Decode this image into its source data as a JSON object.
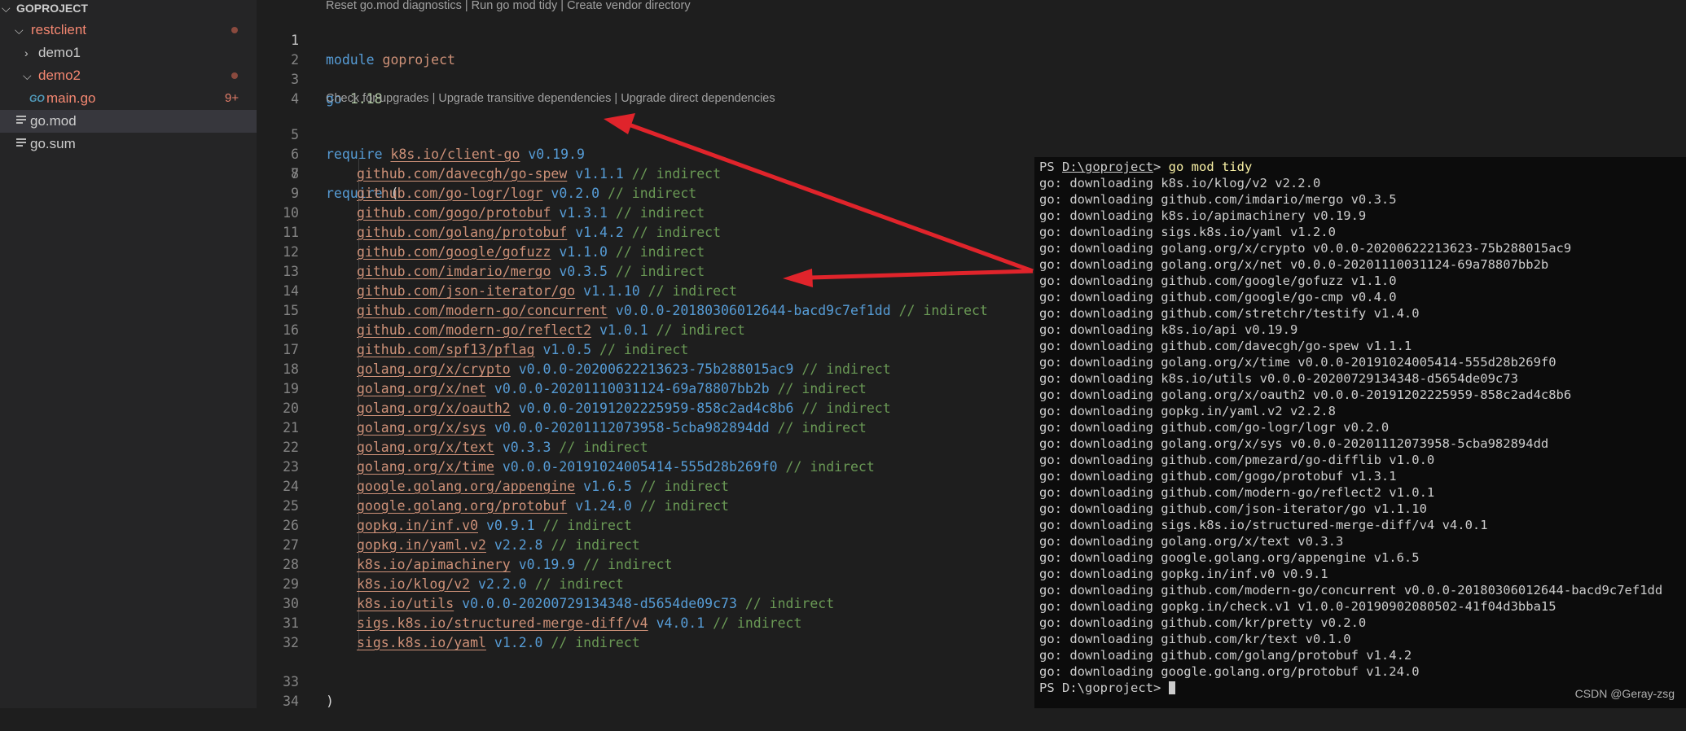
{
  "explorer": {
    "root": "GOPROJECT",
    "items": [
      {
        "label": "restclient",
        "kind": "folder-open",
        "modified": true
      },
      {
        "label": "demo1",
        "kind": "folder-closed"
      },
      {
        "label": "demo2",
        "kind": "folder-open",
        "modified": true
      },
      {
        "label": "main.go",
        "kind": "go-file",
        "problems": "9+",
        "icon_text": "GO"
      },
      {
        "label": "go.mod",
        "kind": "file",
        "selected": true
      },
      {
        "label": "go.sum",
        "kind": "file"
      }
    ]
  },
  "editor": {
    "codelens_top": "Reset go.mod diagnostics | Run go mod tidy | Create vendor directory",
    "codelens_require": "Check for upgrades | Upgrade transitive dependencies | Upgrade direct dependencies",
    "module_kw": "module",
    "module_name": "goproject",
    "go_kw": "go",
    "go_version": "1.18",
    "require_kw": "require",
    "direct_require": {
      "module": "k8s.io/client-go",
      "version": "v0.19.9"
    },
    "open_paren": "(",
    "close_paren": ")",
    "indirect_comment": "// indirect",
    "requires": [
      {
        "module": "github.com/davecgh/go-spew",
        "version": "v1.1.1"
      },
      {
        "module": "github.com/go-logr/logr",
        "version": "v0.2.0"
      },
      {
        "module": "github.com/gogo/protobuf",
        "version": "v1.3.1"
      },
      {
        "module": "github.com/golang/protobuf",
        "version": "v1.4.2"
      },
      {
        "module": "github.com/google/gofuzz",
        "version": "v1.1.0"
      },
      {
        "module": "github.com/imdario/mergo",
        "version": "v0.3.5"
      },
      {
        "module": "github.com/json-iterator/go",
        "version": "v1.1.10"
      },
      {
        "module": "github.com/modern-go/concurrent",
        "version": "v0.0.0-20180306012644-bacd9c7ef1dd"
      },
      {
        "module": "github.com/modern-go/reflect2",
        "version": "v1.0.1"
      },
      {
        "module": "github.com/spf13/pflag",
        "version": "v1.0.5"
      },
      {
        "module": "golang.org/x/crypto",
        "version": "v0.0.0-20200622213623-75b288015ac9"
      },
      {
        "module": "golang.org/x/net",
        "version": "v0.0.0-20201110031124-69a78807bb2b"
      },
      {
        "module": "golang.org/x/oauth2",
        "version": "v0.0.0-20191202225959-858c2ad4c8b6"
      },
      {
        "module": "golang.org/x/sys",
        "version": "v0.0.0-20201112073958-5cba982894dd"
      },
      {
        "module": "golang.org/x/text",
        "version": "v0.3.3"
      },
      {
        "module": "golang.org/x/time",
        "version": "v0.0.0-20191024005414-555d28b269f0"
      },
      {
        "module": "google.golang.org/appengine",
        "version": "v1.6.5"
      },
      {
        "module": "google.golang.org/protobuf",
        "version": "v1.24.0"
      },
      {
        "module": "gopkg.in/inf.v0",
        "version": "v0.9.1"
      },
      {
        "module": "gopkg.in/yaml.v2",
        "version": "v2.2.8"
      },
      {
        "module": "k8s.io/apimachinery",
        "version": "v0.19.9"
      },
      {
        "module": "k8s.io/klog/v2",
        "version": "v2.2.0"
      },
      {
        "module": "k8s.io/utils",
        "version": "v0.0.0-20200729134348-d5654de09c73"
      },
      {
        "module": "sigs.k8s.io/structured-merge-diff/v4",
        "version": "v4.0.1"
      },
      {
        "module": "sigs.k8s.io/yaml",
        "version": "v1.2.0"
      }
    ],
    "line_numbers": [
      "1",
      "2",
      "3",
      "4",
      "5",
      "6",
      "7",
      "8",
      "9",
      "10",
      "11",
      "12",
      "13",
      "14",
      "15",
      "16",
      "17",
      "18",
      "19",
      "20",
      "21",
      "22",
      "23",
      "24",
      "25",
      "26",
      "27",
      "28",
      "29",
      "30",
      "31",
      "32",
      "33",
      "34"
    ]
  },
  "terminal": {
    "prompt_prefix": "PS ",
    "prompt_path": "D:\\goproject",
    "prompt_suffix": "> ",
    "command": "go mod tidy",
    "output": [
      "go: downloading k8s.io/klog/v2 v2.2.0",
      "go: downloading github.com/imdario/mergo v0.3.5",
      "go: downloading k8s.io/apimachinery v0.19.9",
      "go: downloading sigs.k8s.io/yaml v1.2.0",
      "go: downloading golang.org/x/crypto v0.0.0-20200622213623-75b288015ac9",
      "go: downloading golang.org/x/net v0.0.0-20201110031124-69a78807bb2b",
      "go: downloading github.com/google/gofuzz v1.1.0",
      "go: downloading github.com/google/go-cmp v0.4.0",
      "go: downloading github.com/stretchr/testify v1.4.0",
      "go: downloading k8s.io/api v0.19.9",
      "go: downloading github.com/davecgh/go-spew v1.1.1",
      "go: downloading golang.org/x/time v0.0.0-20191024005414-555d28b269f0",
      "go: downloading k8s.io/utils v0.0.0-20200729134348-d5654de09c73",
      "go: downloading golang.org/x/oauth2 v0.0.0-20191202225959-858c2ad4c8b6",
      "go: downloading gopkg.in/yaml.v2 v2.2.8",
      "go: downloading github.com/go-logr/logr v0.2.0",
      "go: downloading golang.org/x/sys v0.0.0-20201112073958-5cba982894dd",
      "go: downloading github.com/pmezard/go-difflib v1.0.0",
      "go: downloading github.com/gogo/protobuf v1.3.1",
      "go: downloading github.com/modern-go/reflect2 v1.0.1",
      "go: downloading github.com/json-iterator/go v1.1.10",
      "go: downloading sigs.k8s.io/structured-merge-diff/v4 v4.0.1",
      "go: downloading golang.org/x/text v0.3.3",
      "go: downloading google.golang.org/appengine v1.6.5",
      "go: downloading gopkg.in/inf.v0 v0.9.1",
      "go: downloading github.com/modern-go/concurrent v0.0.0-20180306012644-bacd9c7ef1dd",
      "go: downloading gopkg.in/check.v1 v1.0.0-20190902080502-41f04d3bba15",
      "go: downloading github.com/kr/pretty v0.2.0",
      "go: downloading github.com/kr/text v0.1.0",
      "go: downloading github.com/golang/protobuf v1.4.2",
      "go: downloading google.golang.org/protobuf v1.24.0"
    ],
    "final_prompt": "PS D:\\goproject> "
  },
  "watermark": "CSDN @Geray-zsg",
  "colors": {
    "annotation_arrow": "#e0242b",
    "module_path": "#ce9178",
    "version": "#569cd6",
    "comment": "#6a9955",
    "modified_folder": "#f48771"
  }
}
